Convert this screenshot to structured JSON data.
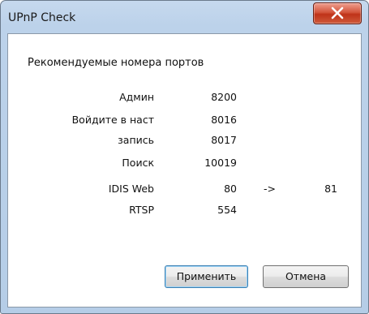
{
  "window": {
    "title": "UPnP Check"
  },
  "dialog": {
    "heading": "Рекомендуемые номера портов",
    "rows": [
      {
        "name": "Админ",
        "value": "8200",
        "arrow": "",
        "value2": ""
      },
      {
        "name": "Войдите в наст",
        "value": "8016",
        "arrow": "",
        "value2": ""
      },
      {
        "name": "запись",
        "value": "8017",
        "arrow": "",
        "value2": ""
      },
      {
        "name": "Поиск",
        "value": "10019",
        "arrow": "",
        "value2": ""
      },
      {
        "name": "IDIS Web",
        "value": "80",
        "arrow": "->",
        "value2": "81"
      },
      {
        "name": "RTSP",
        "value": "554",
        "arrow": "",
        "value2": ""
      }
    ],
    "apply_label": "Применить",
    "cancel_label": "Отмена"
  },
  "icons": {
    "close": "close-icon"
  },
  "colors": {
    "close_button": "#c8452a",
    "frame": "#bcd2ea"
  }
}
